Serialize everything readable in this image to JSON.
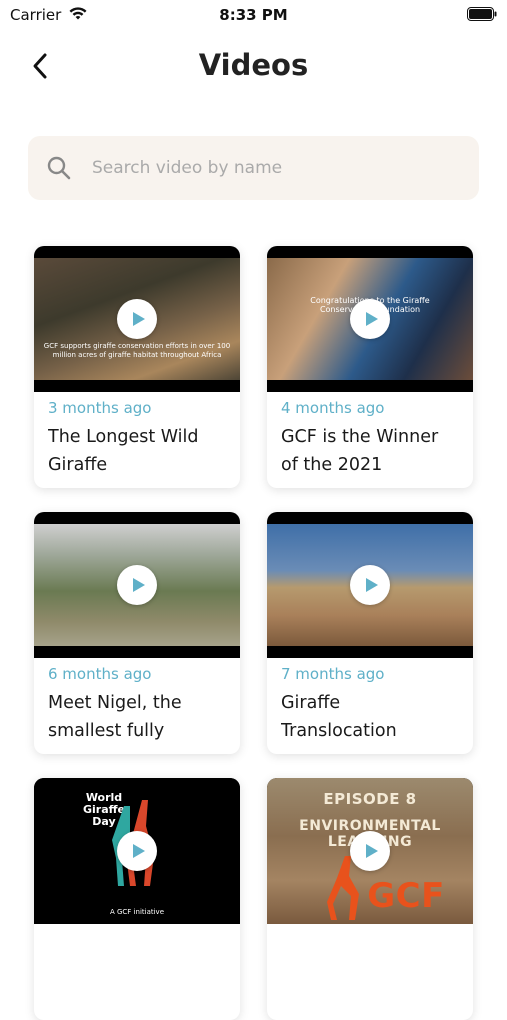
{
  "status_bar": {
    "carrier": "Carrier",
    "time": "8:33 PM"
  },
  "header": {
    "title": "Videos"
  },
  "search": {
    "placeholder": "Search video by name"
  },
  "accent_color": "#5fb0c8",
  "videos": [
    {
      "ago": "3 months ago",
      "title": "The Longest Wild Giraffe",
      "overlay": "GCF supports giraffe conservation efforts in over 100 million acres of giraffe habitat throughout Africa"
    },
    {
      "ago": "4 months ago",
      "title": "GCF is the Winner of the 2021",
      "overlay": "Congratulations to the Giraffe Conservation Foundation"
    },
    {
      "ago": "6 months ago",
      "title": "Meet Nigel, the smallest fully"
    },
    {
      "ago": "7 months ago",
      "title": "Giraffe Translocation"
    },
    {
      "overlay": "World Giraffe Day",
      "overlay2": "A GCF initiative"
    },
    {
      "overlay": "EPISODE 8",
      "overlay2": "ENVIRONMENTAL LEARNING",
      "overlay3": "GCF"
    }
  ]
}
